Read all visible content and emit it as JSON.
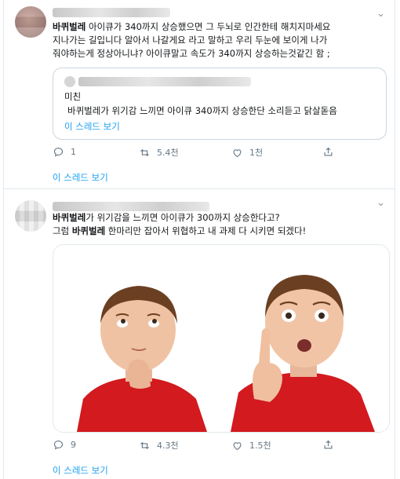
{
  "tweets": [
    {
      "text_lines": [
        [
          {
            "b": "바퀴벌레"
          },
          {
            "t": " 아이큐가 340까지 상승했으면 그 두뇌로 인간한테 해치지마세요"
          }
        ],
        [
          {
            "t": "지나가는 길입니다 알아서 나갈게요 라고 말하고 우리 두눈에 보이게 나가"
          }
        ],
        [
          {
            "t": "줘야하는게 정상아니냐? 아이큐말고 속도가 340까지 상승하는것같긴 함 ;"
          }
        ]
      ],
      "quote": {
        "label": "미친",
        "text": "바퀴벌레가 위기감 느끼면 아이큐 340까지 상승한단 소리듣고 닭살돋음",
        "thread_link": "이 스레드 보기"
      },
      "actions": {
        "replies": "1",
        "retweets": "5.4천",
        "likes": "1천"
      },
      "thread_link": "이 스레드 보기"
    },
    {
      "text_lines": [
        [
          {
            "b": "바퀴벌레"
          },
          {
            "t": "가 위기감을 느끼면 아이큐가 300까지 상승한다고?"
          }
        ],
        [
          {
            "t": "그럼 "
          },
          {
            "b": "바퀴벌레"
          },
          {
            "t": " 한마리만 잡아서 위협하고 내 과제 다 시키면 되겠다!"
          }
        ]
      ],
      "image": {
        "description": "two-boys-thinking"
      },
      "actions": {
        "replies": "9",
        "retweets": "4.3천",
        "likes": "1.5천"
      },
      "thread_link": "이 스레드 보기"
    }
  ],
  "colors": {
    "link": "#1da1f2",
    "muted": "#657786",
    "border": "#e1e8ed"
  }
}
